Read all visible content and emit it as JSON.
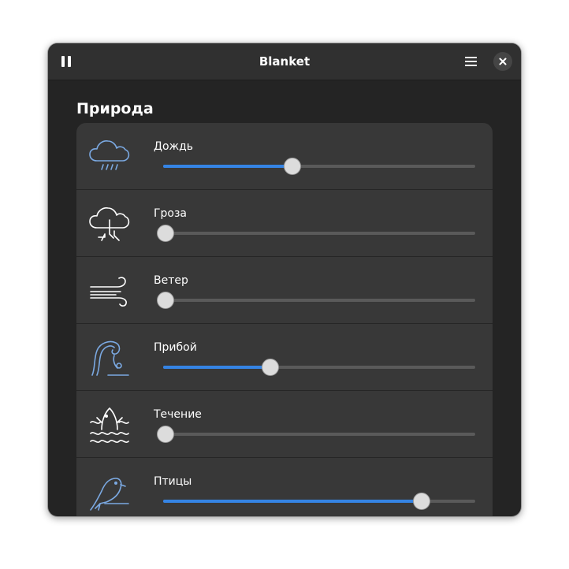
{
  "app": {
    "title": "Blanket",
    "accent_color": "#3584e4",
    "header_icons": [
      "pause-icon",
      "menu-icon",
      "close-icon"
    ]
  },
  "section": {
    "title": "Природа",
    "sounds": [
      {
        "label": "Дождь",
        "icon": "rain-cloud-icon",
        "volume": 0.41,
        "active": true
      },
      {
        "label": "Гроза",
        "icon": "storm-cloud-icon",
        "volume": 0.0,
        "active": false
      },
      {
        "label": "Ветер",
        "icon": "wind-icon",
        "volume": 0.0,
        "active": false
      },
      {
        "label": "Прибой",
        "icon": "wave-icon",
        "volume": 0.34,
        "active": true
      },
      {
        "label": "Течение",
        "icon": "stream-fish-icon",
        "volume": 0.0,
        "active": false
      },
      {
        "label": "Птицы",
        "icon": "bird-icon",
        "volume": 0.83,
        "active": true
      }
    ]
  }
}
